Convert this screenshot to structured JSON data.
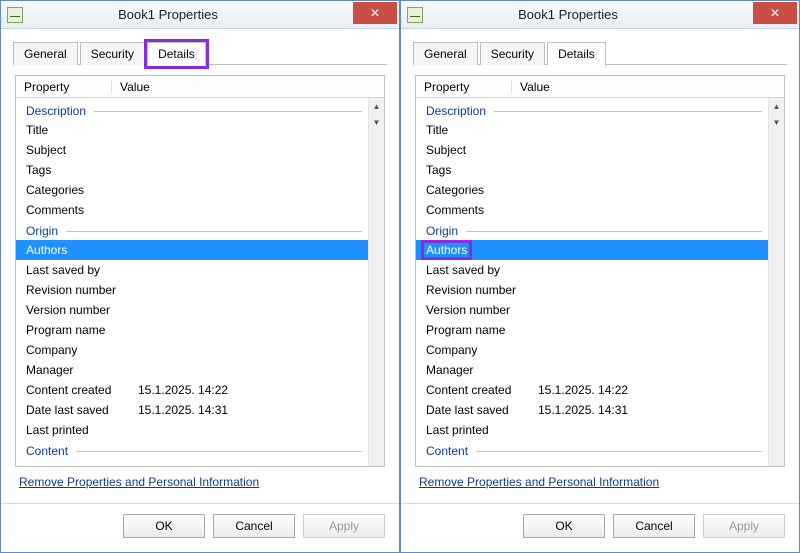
{
  "window": {
    "title": "Book1 Properties",
    "close_glyph": "✕"
  },
  "tabs": {
    "general": "General",
    "security": "Security",
    "details": "Details"
  },
  "columns": {
    "property": "Property",
    "value": "Value"
  },
  "sections": {
    "description": "Description",
    "origin": "Origin",
    "content": "Content"
  },
  "rows": {
    "title": "Title",
    "subject": "Subject",
    "tags": "Tags",
    "categories": "Categories",
    "comments": "Comments",
    "authors": "Authors",
    "last_saved_by": "Last saved by",
    "revision_number": "Revision number",
    "version_number": "Version number",
    "program_name": "Program name",
    "company": "Company",
    "manager": "Manager",
    "content_created": "Content created",
    "date_last_saved": "Date last saved",
    "last_printed": "Last printed"
  },
  "values": {
    "content_created": "15.1.2025. 14:22",
    "date_last_saved": "15.1.2025. 14:31"
  },
  "link": "Remove Properties and Personal Information",
  "buttons": {
    "ok": "OK",
    "cancel": "Cancel",
    "apply": "Apply"
  }
}
